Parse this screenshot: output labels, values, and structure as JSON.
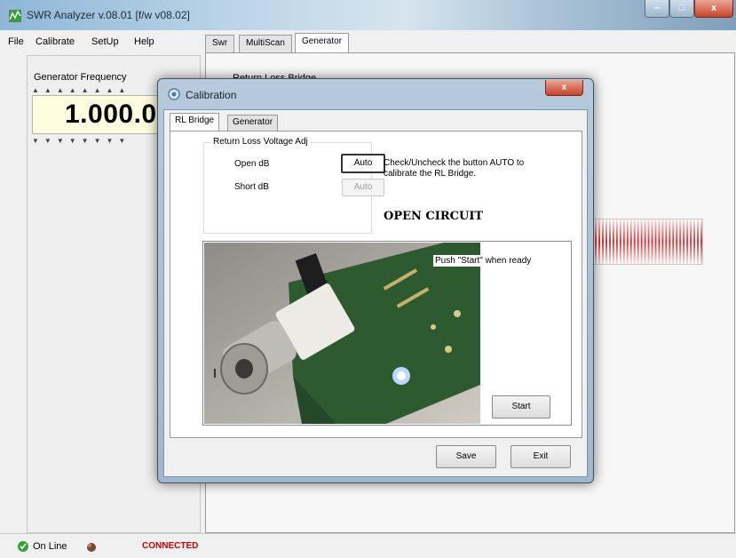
{
  "window": {
    "title": "SWR Analyzer v.08.01 [f/w v08.02]",
    "controls": {
      "minimize": "–",
      "maximize": "□",
      "close": "x"
    }
  },
  "menu": [
    "File",
    "Calibrate",
    "SetUp",
    "Help"
  ],
  "left_panel": {
    "label": "Generator Frequency",
    "frequency": "1.000.00",
    "up_arrows": "▲▲▲▲▲▲▲▲",
    "down_arrows": "▼▼▼▼▼▼▼▼"
  },
  "main_tabs": [
    "Swr",
    "MultiScan",
    "Generator"
  ],
  "main_active_tab": "Generator",
  "background_panel_label": "Return Loss Bridge",
  "status": {
    "online": "On Line",
    "connection": "CONNECTED"
  },
  "dialog": {
    "title": "Calibration",
    "close": "x",
    "tabs": [
      "RL Bridge",
      "Generator"
    ],
    "active_tab": "RL Bridge",
    "group_title": "Return Loss Voltage Adj",
    "open_label": "Open dB",
    "short_label": "Short dB",
    "auto_label": "Auto",
    "instructions": "Check/Uncheck the button AUTO to calibrate the RL Bridge.",
    "state_text": "OPEN CIRCUIT",
    "photo_message": "Push \"Start\" when ready",
    "start_label": "Start",
    "save_label": "Save",
    "exit_label": "Exit"
  },
  "colors": {
    "connected": "#cc0000",
    "frequency_bg": "#fffde0",
    "signal": "#d23030",
    "pcb": "#2e5a30",
    "titlebar": "#b9d3e6"
  }
}
